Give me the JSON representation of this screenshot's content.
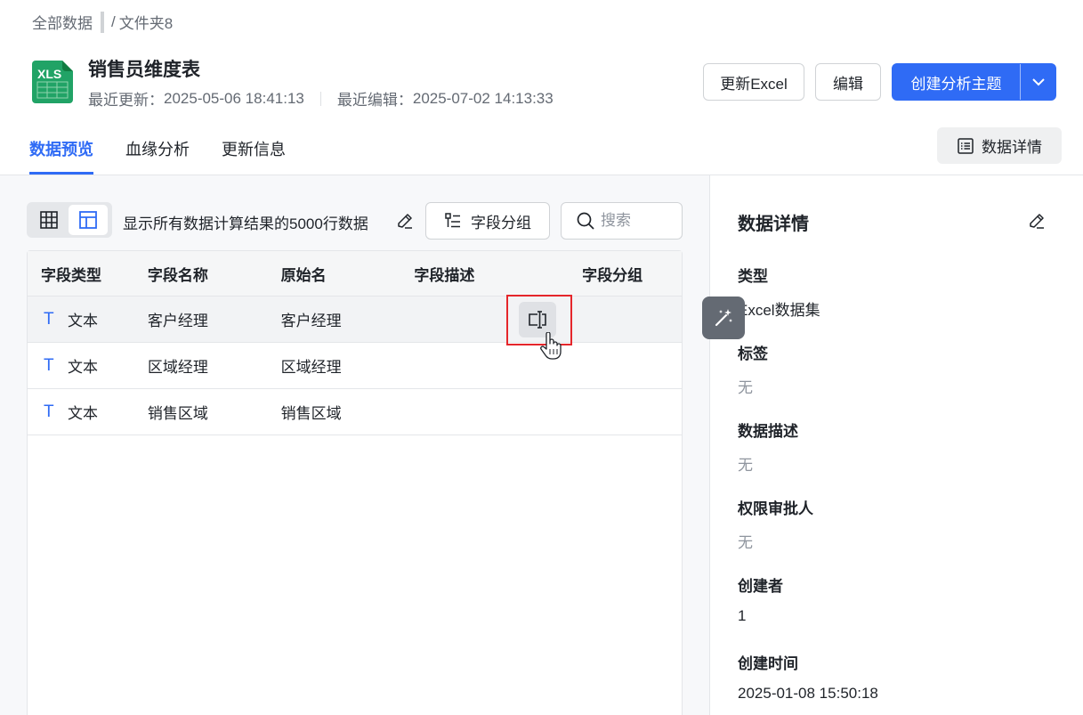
{
  "breadcrumb": {
    "root": "全部数据",
    "separator": "/",
    "current": "文件夹8"
  },
  "header": {
    "title": "销售员维度表",
    "last_updated_label": "最近更新：",
    "last_updated": "2025-05-06 18:41:13",
    "last_edited_label": "最近编辑：",
    "last_edited": "2025-07-02 14:13:33",
    "file_icon_text": "XLS"
  },
  "actions": {
    "update_excel": "更新Excel",
    "edit": "编辑",
    "create_topic": "创建分析主题"
  },
  "tabs": [
    "数据预览",
    "血缘分析",
    "更新信息"
  ],
  "detail_button": "数据详情",
  "toolbar": {
    "summary": "显示所有数据计算结果的5000行数据",
    "field_group": "字段分组",
    "search_placeholder": "搜索"
  },
  "table": {
    "headers": [
      "字段类型",
      "字段名称",
      "原始名",
      "字段描述",
      "字段分组"
    ],
    "rows": [
      {
        "type_icon": "T",
        "type": "文本",
        "name": "客户经理",
        "original": "客户经理",
        "description": "",
        "group": ""
      },
      {
        "type_icon": "T",
        "type": "文本",
        "name": "区域经理",
        "original": "区域经理",
        "description": "",
        "group": ""
      },
      {
        "type_icon": "T",
        "type": "文本",
        "name": "销售区域",
        "original": "销售区域",
        "description": "",
        "group": ""
      }
    ]
  },
  "details": {
    "title": "数据详情",
    "fields": [
      {
        "label": "类型",
        "value": "Excel数据集",
        "muted": false
      },
      {
        "label": "标签",
        "value": "无",
        "muted": true
      },
      {
        "label": "数据描述",
        "value": "无",
        "muted": true
      },
      {
        "label": "权限审批人",
        "value": "无",
        "muted": true
      },
      {
        "label": "创建者",
        "value": "1",
        "muted": false
      },
      {
        "label": "创建时间",
        "value": "2025-01-08 15:50:18",
        "muted": false
      }
    ]
  },
  "colors": {
    "accent": "#2f6bf5",
    "highlight": "#e5262b",
    "excel_green": "#21a366"
  }
}
